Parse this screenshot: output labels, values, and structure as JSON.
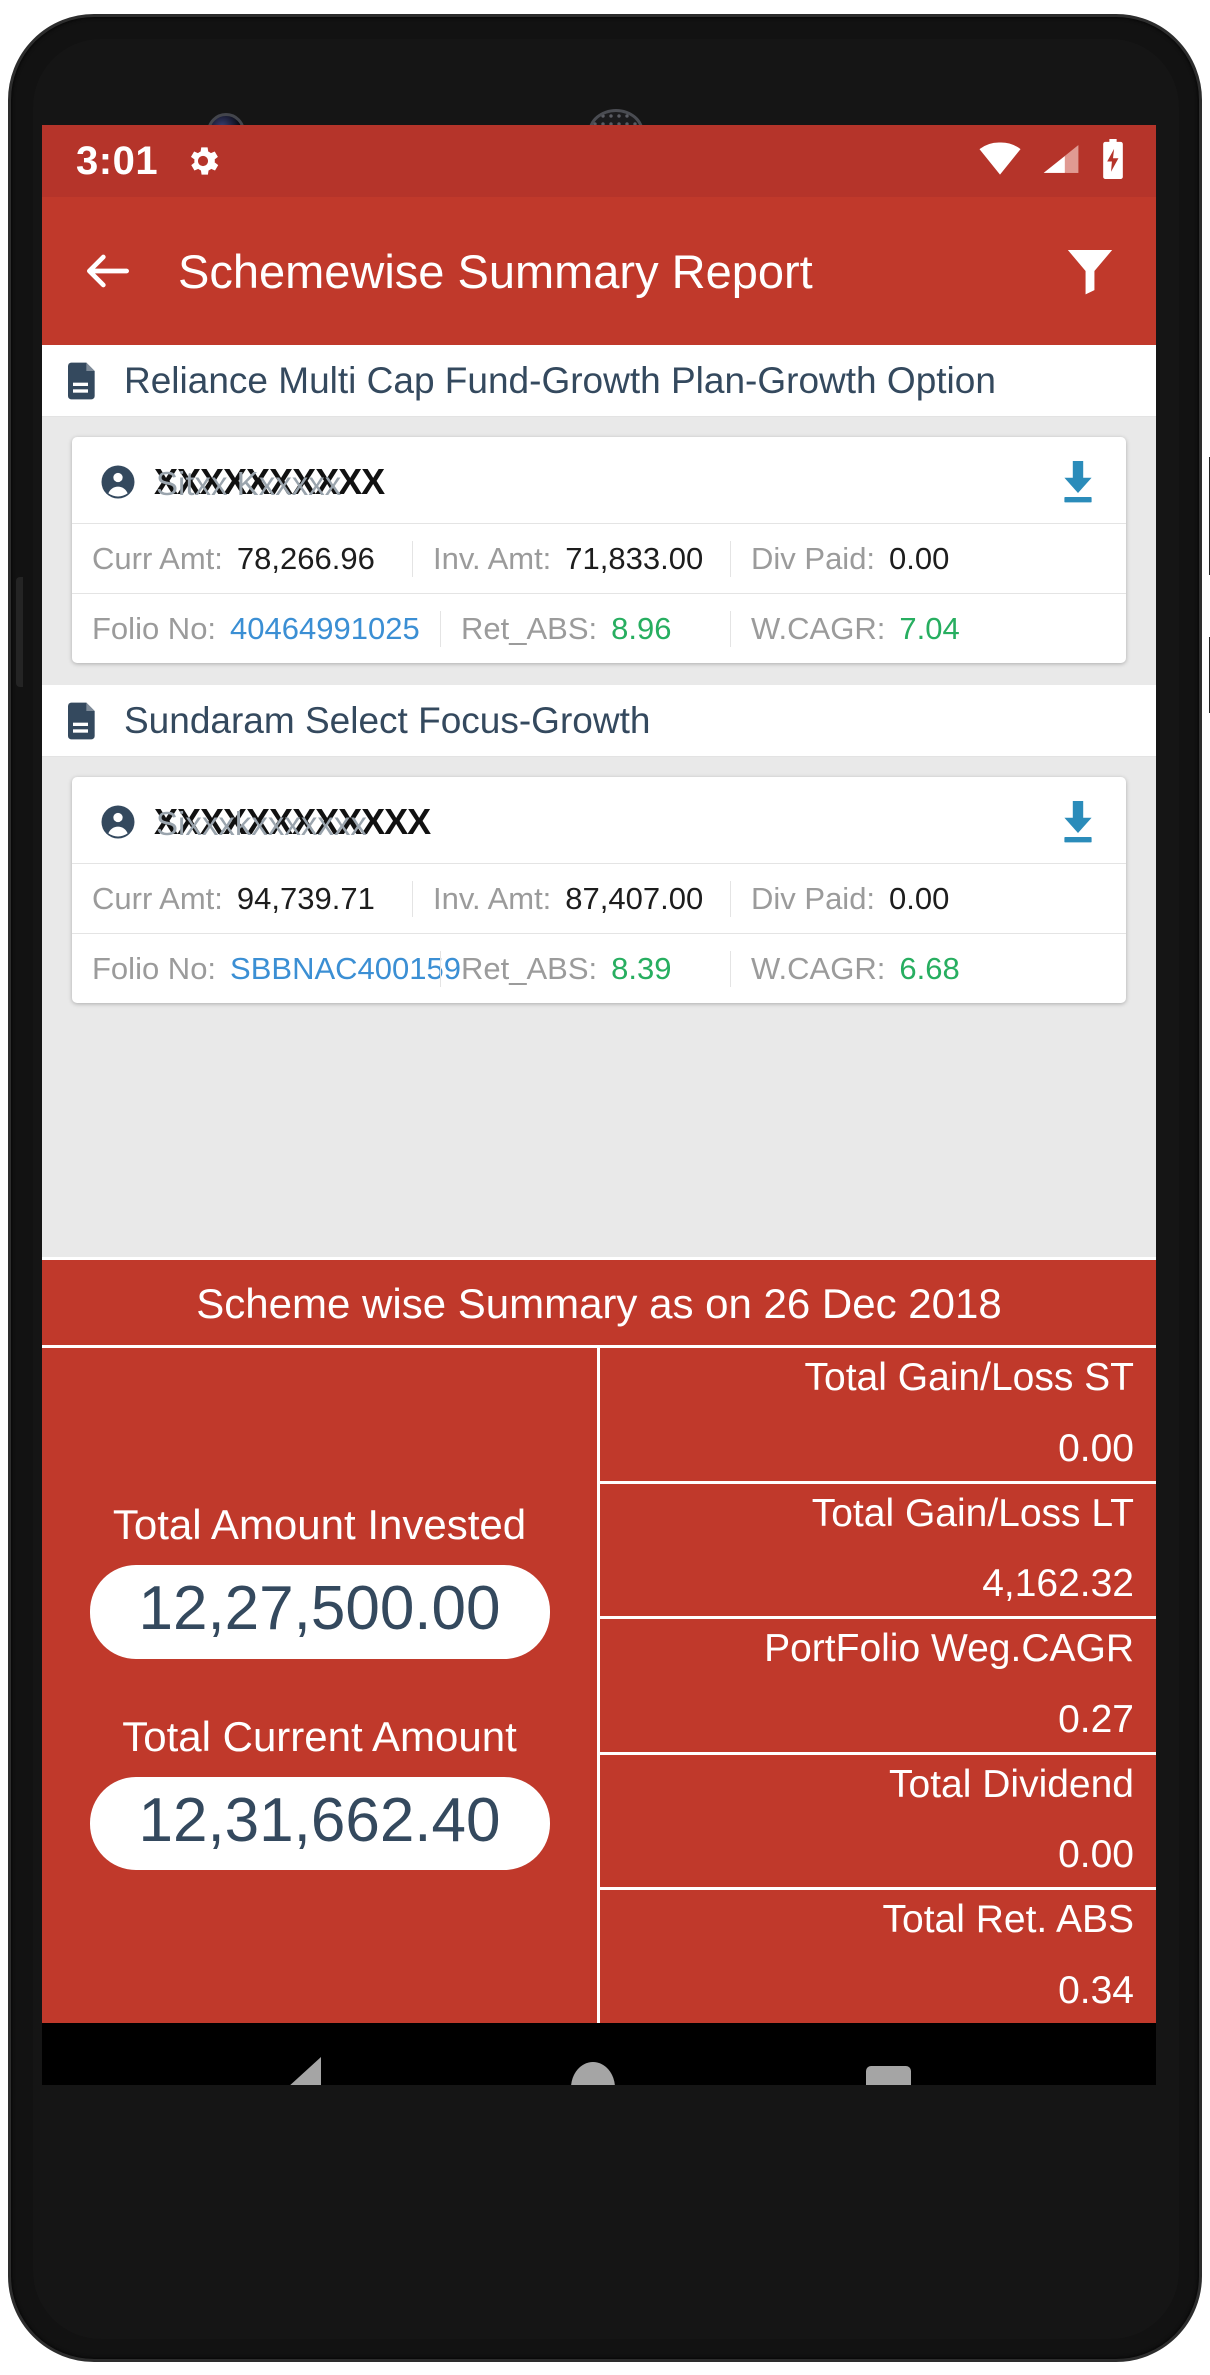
{
  "status_bar": {
    "time": "3:01",
    "gear_icon": "gear-icon",
    "wifi_icon": "wifi-icon",
    "signal_icon": "cellular-signal-icon",
    "battery_icon": "battery-charging-icon"
  },
  "app_bar": {
    "back_icon": "back-arrow-icon",
    "title": "Schemewise Summary Report",
    "filter_icon": "filter-funnel-icon"
  },
  "schemes": [
    {
      "name": "Reliance Multi Cap Fund-Growth Plan-Growth Option",
      "doc_icon": "document-icon",
      "investor": {
        "masked_name": "XXXXXXXXXX",
        "underlying_name": "Sitxx Kxxxxx",
        "person_icon": "person-icon",
        "download_icon": "download-icon"
      },
      "row_a": [
        {
          "label": "Curr Amt:",
          "value": "78,266.96",
          "style": "plain"
        },
        {
          "label": "Inv. Amt:",
          "value": "71,833.00",
          "style": "plain"
        },
        {
          "label": "Div Paid:",
          "value": "0.00",
          "style": "plain"
        }
      ],
      "row_b": [
        {
          "label": "Folio No:",
          "value": "40464991025",
          "style": "link"
        },
        {
          "label": "Ret_ABS:",
          "value": "8.96",
          "style": "pos"
        },
        {
          "label": "W.CAGR:",
          "value": "7.04",
          "style": "pos"
        }
      ]
    },
    {
      "name": "Sundaram Select Focus-Growth",
      "doc_icon": "document-icon",
      "investor": {
        "masked_name": "XXXXXXXXXXXX",
        "underlying_name": "Sixxxkxxxxxxx",
        "person_icon": "person-icon",
        "download_icon": "download-icon"
      },
      "row_a": [
        {
          "label": "Curr Amt:",
          "value": "94,739.71",
          "style": "plain"
        },
        {
          "label": "Inv. Amt:",
          "value": "87,407.00",
          "style": "plain"
        },
        {
          "label": "Div Paid:",
          "value": "0.00",
          "style": "plain"
        }
      ],
      "row_b": [
        {
          "label": "Folio No:",
          "value": "SBBNAC400159",
          "style": "link"
        },
        {
          "label": "Ret_ABS:",
          "value": "8.39",
          "style": "pos"
        },
        {
          "label": "W.CAGR:",
          "value": "6.68",
          "style": "pos"
        }
      ]
    }
  ],
  "summary": {
    "title": "Scheme wise Summary as on 26 Dec 2018",
    "invested_label": "Total Amount Invested",
    "invested_value": "12,27,500.00",
    "current_label": "Total Current Amount",
    "current_value": "12,31,662.40",
    "metrics": [
      {
        "key": "Total Gain/Loss ST",
        "value": "0.00"
      },
      {
        "key": "Total Gain/Loss LT",
        "value": "4,162.32"
      },
      {
        "key": "PortFolio Weg.CAGR",
        "value": "0.27"
      },
      {
        "key": "Total Dividend",
        "value": "0.00"
      },
      {
        "key": "Total Ret. ABS",
        "value": "0.34"
      }
    ]
  },
  "nav_bar": {
    "back_icon": "nav-back-triangle-icon",
    "home_icon": "nav-home-circle-icon",
    "recents_icon": "nav-recents-square-icon"
  },
  "colors": {
    "primary_red": "#c0392b",
    "status_red": "#b5342a",
    "link_blue": "#3b8fd4",
    "positive_green": "#27ae60",
    "navy_text": "#34495e",
    "download_blue": "#2b8cba"
  }
}
